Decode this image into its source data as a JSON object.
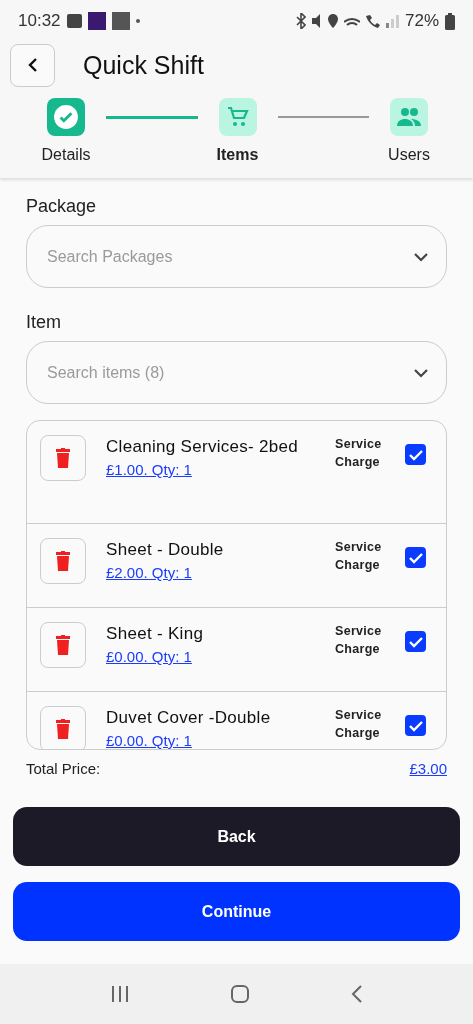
{
  "status_bar": {
    "time": "10:32",
    "battery": "72%"
  },
  "header": {
    "title": "Quick Shift"
  },
  "steps": [
    {
      "label": "Details",
      "kind": "done",
      "selected": false
    },
    {
      "label": "Items",
      "kind": "cart",
      "selected": true
    },
    {
      "label": "Users",
      "kind": "users",
      "selected": false
    }
  ],
  "package": {
    "label": "Package",
    "placeholder": "Search Packages"
  },
  "item": {
    "label": "Item",
    "placeholder": "Search items (8)"
  },
  "items": [
    {
      "name": "Cleaning Services- 2bed",
      "price": "£1.00. Qty: 1",
      "service_label": "Service Charge",
      "checked": true
    },
    {
      "name": "Sheet - Double",
      "price": "£2.00. Qty: 1",
      "service_label": "Service Charge",
      "checked": true
    },
    {
      "name": "Sheet - King",
      "price": "£0.00. Qty: 1",
      "service_label": "Service Charge",
      "checked": true
    },
    {
      "name": "Duvet Cover -Double",
      "price": "£0.00. Qty: 1",
      "service_label": "Service Charge",
      "checked": true
    }
  ],
  "total": {
    "label": "Total Price:",
    "value": "£3.00"
  },
  "buttons": [
    {
      "label": "Back",
      "kind": "dark"
    },
    {
      "label": "Continue",
      "kind": "primary"
    }
  ]
}
